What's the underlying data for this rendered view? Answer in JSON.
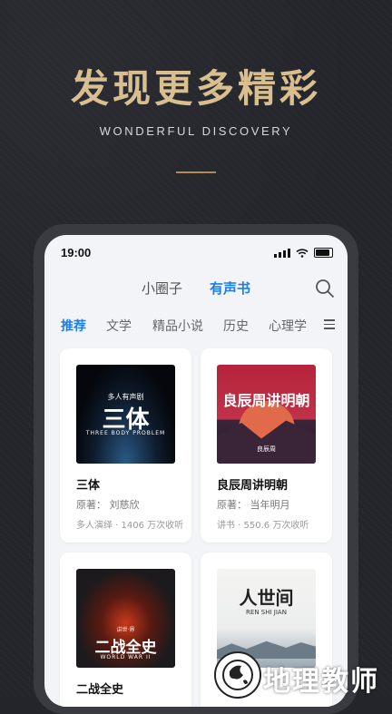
{
  "hero": {
    "title": "发现更多精彩",
    "subtitle": "WONDERFUL DISCOVERY"
  },
  "status_bar": {
    "time": "19:00"
  },
  "top_tabs": [
    {
      "label": "小圈子",
      "active": false
    },
    {
      "label": "有声书",
      "active": true
    }
  ],
  "category_tabs": [
    {
      "label": "推荐",
      "active": true
    },
    {
      "label": "文学",
      "active": false
    },
    {
      "label": "精品小说",
      "active": false
    },
    {
      "label": "历史",
      "active": false
    },
    {
      "label": "心理学",
      "active": false
    }
  ],
  "books": [
    {
      "title": "三体",
      "author": "原著： 刘慈欣",
      "meta": "多人演绎 · 1406 万次收听",
      "cover_text_top": "多人有声剧",
      "cover_text_main": "三体",
      "cover_text_bottom": "THREE BODY PROBLEM"
    },
    {
      "title": "良辰周讲明朝",
      "author": "原著： 当年明月",
      "meta": "讲书 · 550.6 万次收听",
      "cover_text_main": "良辰周讲明朝",
      "cover_text_bottom": "良辰周"
    },
    {
      "title": "二战全史",
      "cover_text_top": "讲世·界",
      "cover_text_main": "二战全史",
      "cover_text_bottom": "WORLD WAR II"
    },
    {
      "cover_text_main": "人世间",
      "cover_text_bottom": "REN SHI JIAN"
    }
  ],
  "watermark": {
    "text": "地理教师"
  },
  "colors": {
    "accent": "#1c7ee8",
    "hero_gold": "#d9bf8f",
    "background": "#24252b"
  }
}
